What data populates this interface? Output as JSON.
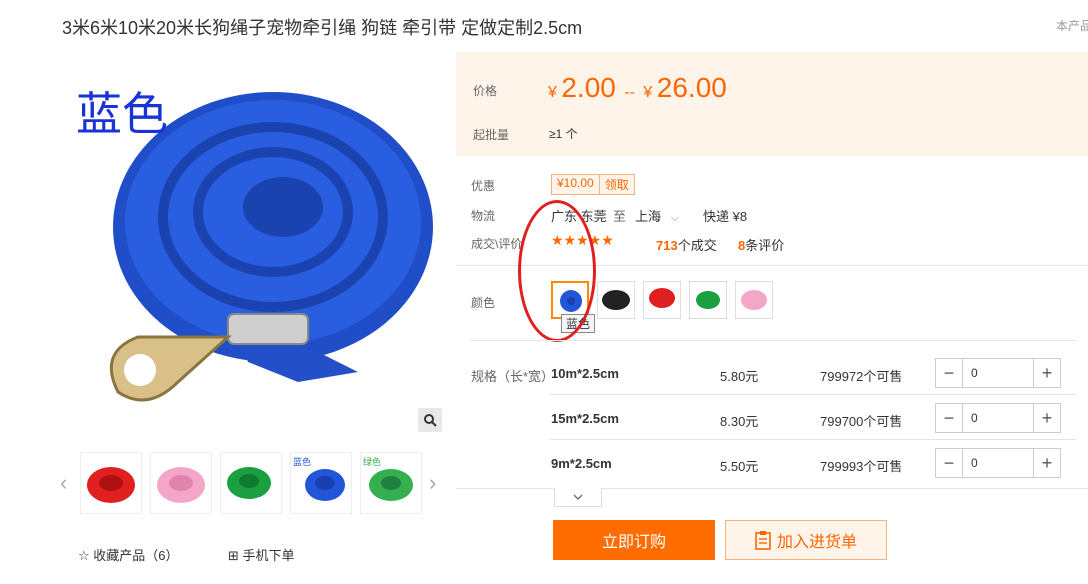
{
  "header": {
    "title": "3米6米10米20米长狗绳子宠物牵引绳 狗链 牵引带 定做定制2.5cm",
    "this_product": "本产品"
  },
  "gallery": {
    "main_overlay_text": "蓝色",
    "zoom_icon": "magnifier-icon",
    "thumbnails": [
      {
        "color": "#e02020",
        "label": ""
      },
      {
        "color": "#f4a6c8",
        "label": ""
      },
      {
        "color": "#1aa040",
        "label": ""
      },
      {
        "color": "#2255d8",
        "label": "蓝色"
      },
      {
        "color": "#35b050",
        "label": "绿色"
      }
    ],
    "favorite_label": "收藏产品（6）",
    "mobile_order_label": "手机下单"
  },
  "price_section": {
    "price_label": "价格",
    "currency": "¥",
    "price_min": "2.00",
    "price_sep": "--",
    "price_max": "26.00",
    "moq_label": "起批量",
    "moq_value": "≥1 个"
  },
  "promo": {
    "label": "优惠",
    "coupon_value": "¥10.00",
    "coupon_action": "领取"
  },
  "logistics": {
    "label": "物流",
    "from": "广东 东莞",
    "to_word": "至",
    "to": "上海",
    "express": "快递 ¥8"
  },
  "deals": {
    "label": "成交\\评价",
    "stars": "★★★★★",
    "deal_count": "713",
    "deal_suffix": "个成交",
    "review_count": "8",
    "review_suffix": "条评价"
  },
  "colors": {
    "label": "颜色",
    "swatches": [
      {
        "name": "蓝",
        "color": "#2255d8"
      },
      {
        "name": "黑",
        "color": "#222222"
      },
      {
        "name": "红",
        "color": "#e02020"
      },
      {
        "name": "绿",
        "color": "#1aa040"
      },
      {
        "name": "粉",
        "color": "#f4a6c8"
      }
    ],
    "tooltip": "蓝色"
  },
  "specs": {
    "label": "规格（长*宽）",
    "rows": [
      {
        "name": "10m*2.5cm",
        "price": "5.80元",
        "stock": "799972个可售",
        "qty": "0"
      },
      {
        "name": "15m*2.5cm",
        "price": "8.30元",
        "stock": "799700个可售",
        "qty": "0"
      },
      {
        "name": "9m*2.5cm",
        "price": "5.50元",
        "stock": "799993个可售",
        "qty": "0"
      }
    ],
    "minus": "−",
    "plus": "+",
    "more_icon": "chevron-down-icon"
  },
  "actions": {
    "buy_now": "立即订购",
    "add_to_cart": "加入进货单"
  }
}
